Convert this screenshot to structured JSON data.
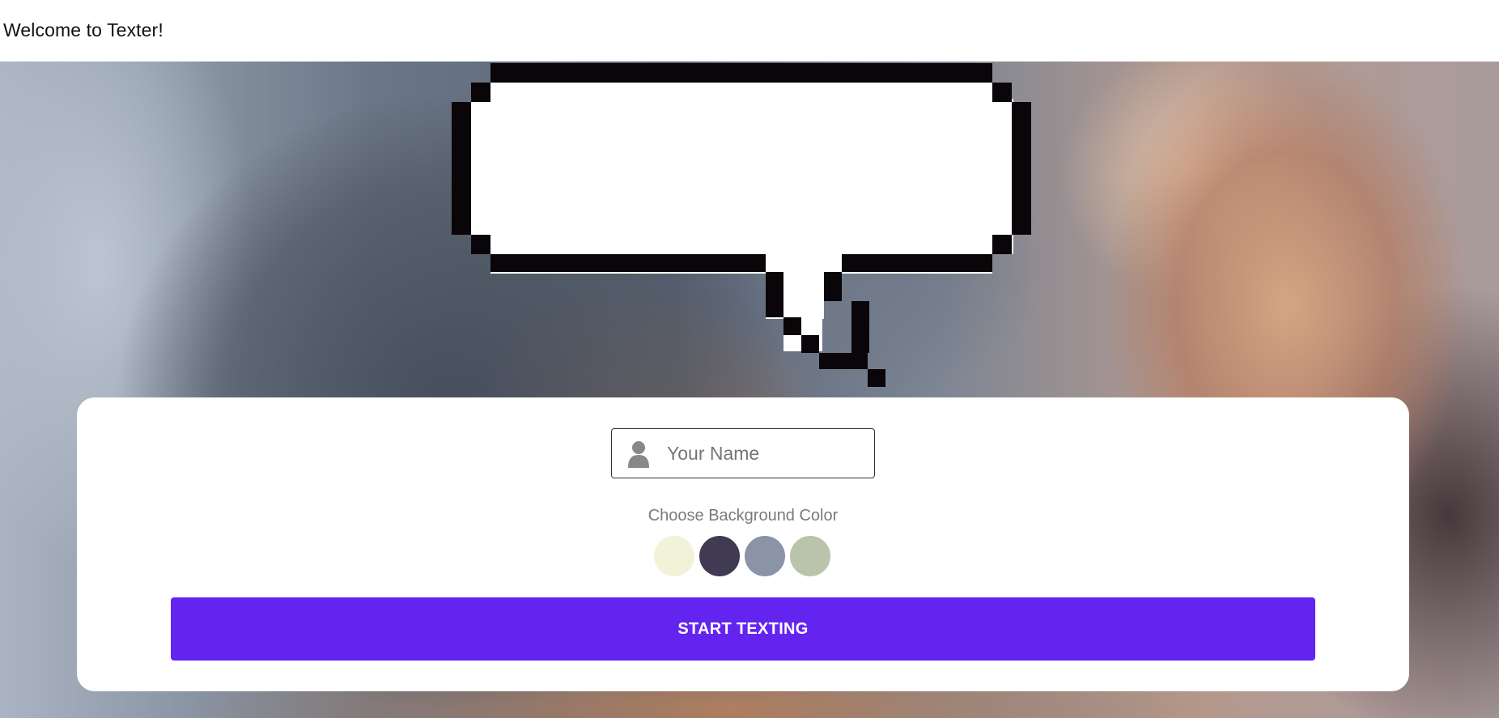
{
  "header": {
    "title": "Welcome to Texter!"
  },
  "hero": {
    "bubble_icon": "pixel-speech-bubble-icon"
  },
  "form": {
    "name_input": {
      "placeholder": "Your Name",
      "value": "",
      "icon": "person-icon"
    },
    "color_label": "Choose Background Color",
    "colors": [
      {
        "name": "cream",
        "hex": "#f2f2d8"
      },
      {
        "name": "dark-purple",
        "hex": "#403b53"
      },
      {
        "name": "slate-gray",
        "hex": "#8a94a6"
      },
      {
        "name": "sage-green",
        "hex": "#b9c4ab"
      }
    ],
    "start_label": "START TEXTING",
    "start_color": "#6424f0"
  }
}
